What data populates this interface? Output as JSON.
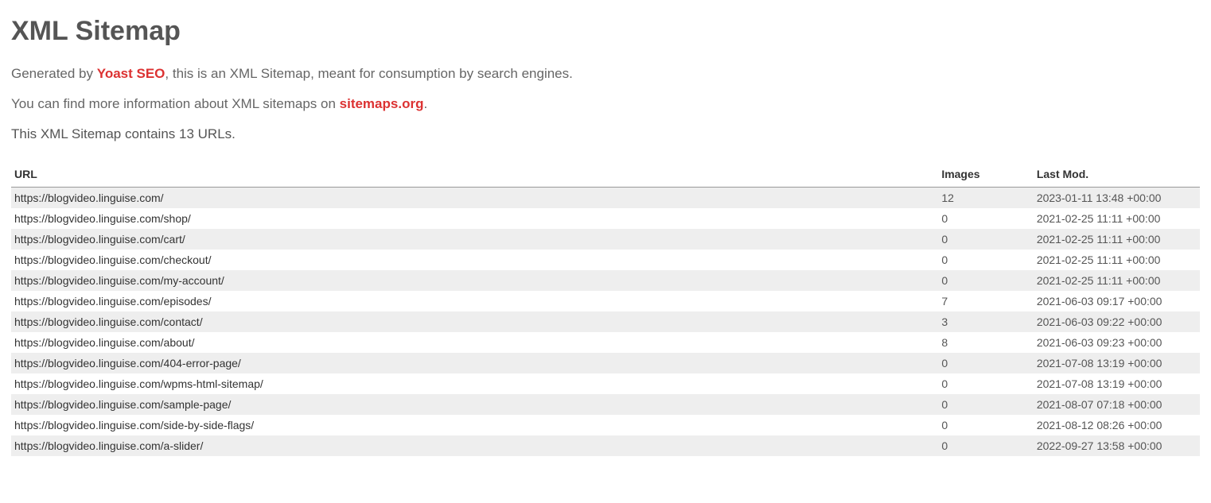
{
  "title": "XML Sitemap",
  "intro1_prefix": "Generated by ",
  "intro1_link": "Yoast SEO",
  "intro1_suffix": ", this is an XML Sitemap, meant for consumption by search engines.",
  "intro2_prefix": "You can find more information about XML sitemaps on ",
  "intro2_link": "sitemaps.org",
  "intro2_suffix": ".",
  "count_text": "This XML Sitemap contains 13 URLs.",
  "headers": {
    "url": "URL",
    "images": "Images",
    "lastmod": "Last Mod."
  },
  "rows": [
    {
      "url": "https://blogvideo.linguise.com/",
      "images": "12",
      "lastmod": "2023-01-11 13:48 +00:00"
    },
    {
      "url": "https://blogvideo.linguise.com/shop/",
      "images": "0",
      "lastmod": "2021-02-25 11:11 +00:00"
    },
    {
      "url": "https://blogvideo.linguise.com/cart/",
      "images": "0",
      "lastmod": "2021-02-25 11:11 +00:00"
    },
    {
      "url": "https://blogvideo.linguise.com/checkout/",
      "images": "0",
      "lastmod": "2021-02-25 11:11 +00:00"
    },
    {
      "url": "https://blogvideo.linguise.com/my-account/",
      "images": "0",
      "lastmod": "2021-02-25 11:11 +00:00"
    },
    {
      "url": "https://blogvideo.linguise.com/episodes/",
      "images": "7",
      "lastmod": "2021-06-03 09:17 +00:00"
    },
    {
      "url": "https://blogvideo.linguise.com/contact/",
      "images": "3",
      "lastmod": "2021-06-03 09:22 +00:00"
    },
    {
      "url": "https://blogvideo.linguise.com/about/",
      "images": "8",
      "lastmod": "2021-06-03 09:23 +00:00"
    },
    {
      "url": "https://blogvideo.linguise.com/404-error-page/",
      "images": "0",
      "lastmod": "2021-07-08 13:19 +00:00"
    },
    {
      "url": "https://blogvideo.linguise.com/wpms-html-sitemap/",
      "images": "0",
      "lastmod": "2021-07-08 13:19 +00:00"
    },
    {
      "url": "https://blogvideo.linguise.com/sample-page/",
      "images": "0",
      "lastmod": "2021-08-07 07:18 +00:00"
    },
    {
      "url": "https://blogvideo.linguise.com/side-by-side-flags/",
      "images": "0",
      "lastmod": "2021-08-12 08:26 +00:00"
    },
    {
      "url": "https://blogvideo.linguise.com/a-slider/",
      "images": "0",
      "lastmod": "2022-09-27 13:58 +00:00"
    }
  ]
}
